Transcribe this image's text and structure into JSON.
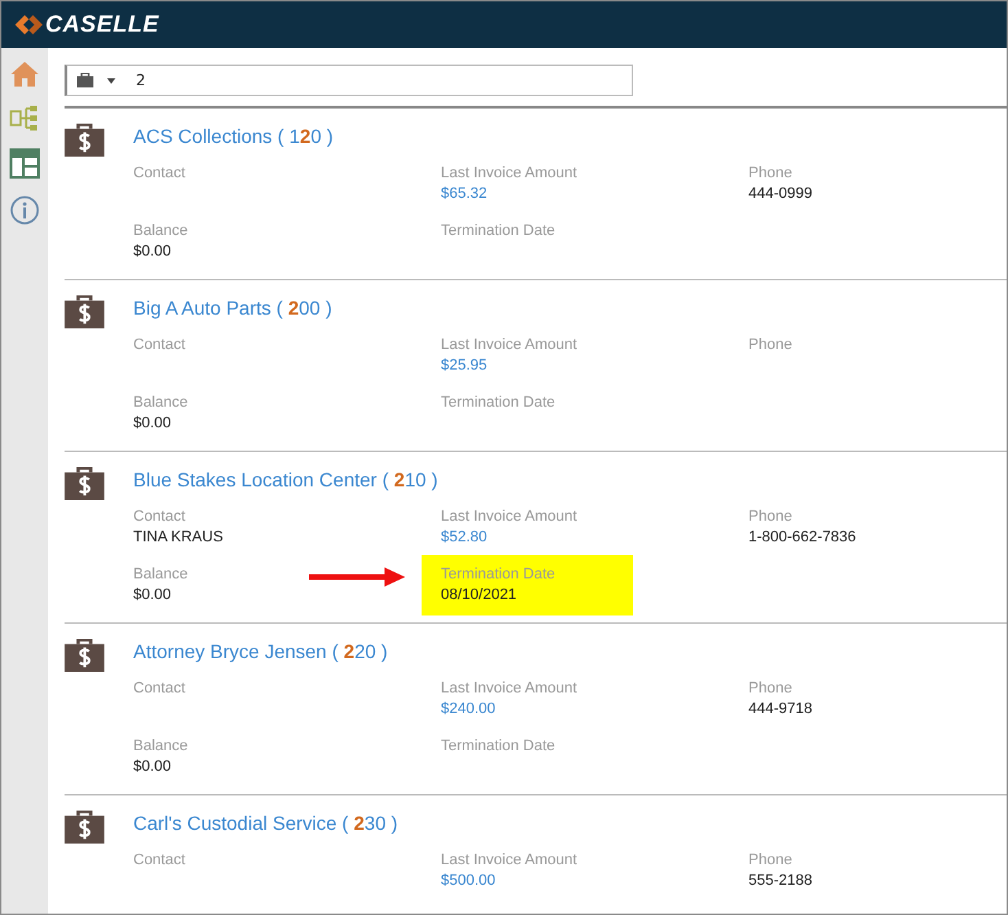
{
  "header": {
    "logo": "CASELLE"
  },
  "sidebar": {
    "items": [
      {
        "kind": "home"
      },
      {
        "kind": "tree"
      },
      {
        "kind": "layout"
      },
      {
        "kind": "info"
      }
    ]
  },
  "search": {
    "value": "2"
  },
  "vendors": [
    {
      "title": {
        "before": "ACS Collections ( 1",
        "match": "2",
        "after": "0 )"
      },
      "fields": [
        {
          "label": "Contact",
          "highlighted": false,
          "marked": false
        },
        {
          "label": "Last Invoice Amount",
          "value": "$65.32",
          "kind": "link",
          "highlighted": false,
          "marked": false
        },
        {
          "label": "Phone",
          "value": "444-0999",
          "kind": "text",
          "highlighted": false,
          "marked": false
        },
        {
          "label": "Balance",
          "value": "$0.00",
          "kind": "text",
          "highlighted": false,
          "marked": false
        },
        {
          "label": "Termination Date",
          "highlighted": false,
          "marked": false
        }
      ]
    },
    {
      "title": {
        "before": "Big A Auto Parts ( ",
        "match": "2",
        "after": "00 )"
      },
      "fields": [
        {
          "label": "Contact",
          "highlighted": false,
          "marked": false
        },
        {
          "label": "Last Invoice Amount",
          "value": "$25.95",
          "kind": "link",
          "highlighted": false,
          "marked": false
        },
        {
          "label": "Phone",
          "highlighted": false,
          "marked": false
        },
        {
          "label": "Balance",
          "value": "$0.00",
          "kind": "text",
          "highlighted": false,
          "marked": false
        },
        {
          "label": "Termination Date",
          "highlighted": false,
          "marked": false
        }
      ]
    },
    {
      "title": {
        "before": "Blue Stakes Location Center ( ",
        "match": "2",
        "after": "10 )"
      },
      "fields": [
        {
          "label": "Contact",
          "value": "TINA KRAUS",
          "kind": "text",
          "highlighted": false,
          "marked": false
        },
        {
          "label": "Last Invoice Amount",
          "value": "$52.80",
          "kind": "link",
          "highlighted": false,
          "marked": false
        },
        {
          "label": "Phone",
          "value": "1-800-662-7836",
          "kind": "text",
          "highlighted": false,
          "marked": false
        },
        {
          "label": "Balance",
          "value": "$0.00",
          "kind": "text",
          "highlighted": false,
          "marked": false
        },
        {
          "label": "Termination Date",
          "value": "08/10/2021",
          "kind": "text",
          "highlighted": true,
          "marked": true
        }
      ]
    },
    {
      "title": {
        "before": "Attorney Bryce Jensen ( ",
        "match": "2",
        "after": "20 )"
      },
      "fields": [
        {
          "label": "Contact",
          "highlighted": false,
          "marked": false
        },
        {
          "label": "Last Invoice Amount",
          "value": "$240.00",
          "kind": "link",
          "highlighted": false,
          "marked": false
        },
        {
          "label": "Phone",
          "value": "444-9718",
          "kind": "text",
          "highlighted": false,
          "marked": false
        },
        {
          "label": "Balance",
          "value": "$0.00",
          "kind": "text",
          "highlighted": false,
          "marked": false
        },
        {
          "label": "Termination Date",
          "highlighted": false,
          "marked": false
        }
      ]
    },
    {
      "title": {
        "before": "Carl's Custodial Service ( ",
        "match": "2",
        "after": "30 )"
      },
      "fields": [
        {
          "label": "Contact",
          "highlighted": false,
          "marked": false
        },
        {
          "label": "Last Invoice Amount",
          "value": "$500.00",
          "kind": "link",
          "highlighted": false,
          "marked": false
        },
        {
          "label": "Phone",
          "value": "555-2188",
          "kind": "text",
          "highlighted": false,
          "marked": false
        }
      ]
    }
  ]
}
